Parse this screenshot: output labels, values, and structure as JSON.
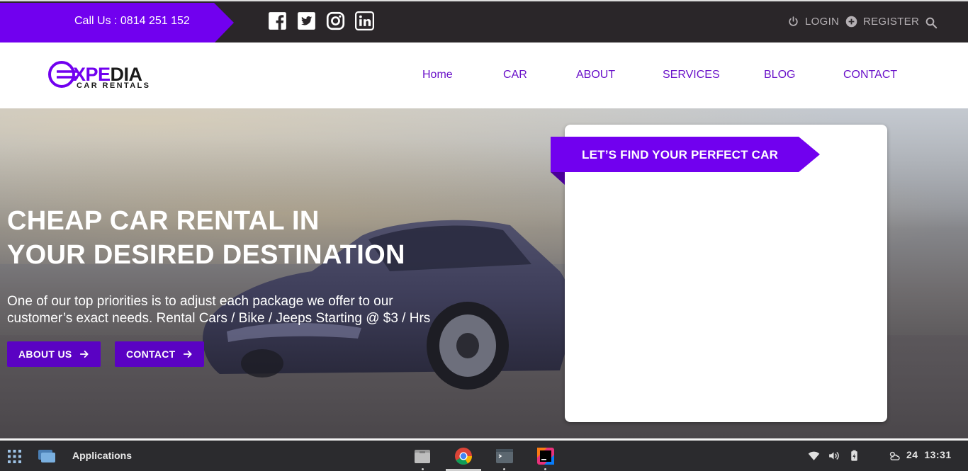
{
  "topbar": {
    "call_text": "Call Us : 0814 251 152",
    "social": [
      "facebook-icon",
      "twitter-icon",
      "instagram-icon",
      "linkedin-icon"
    ],
    "login": "LOGIN",
    "register": "REGISTER",
    "accent": "#7100ef"
  },
  "header": {
    "logo_main_a": "XPE",
    "logo_main_b": "DIA",
    "logo_sub": "CAR RENTALS",
    "nav": [
      "Home",
      "CAR",
      "ABOUT",
      "SERVICES",
      "BLOG",
      "CONTACT"
    ]
  },
  "hero": {
    "headline_line1": "CHEAP CAR RENTAL IN",
    "headline_line2": "YOUR DESIRED DESTINATION",
    "subtext": "One of our top priorities is to adjust each package we offer to our customer’s exact needs. Rental Cars / Bike / Jeeps Starting @ $3 / Hrs",
    "about_button": "ABOUT US",
    "contact_button": "CONTACT"
  },
  "finder": {
    "title": "LET’S FIND YOUR PERFECT CAR"
  },
  "taskbar": {
    "applications": "Applications",
    "date": "24",
    "time": "13:31"
  }
}
